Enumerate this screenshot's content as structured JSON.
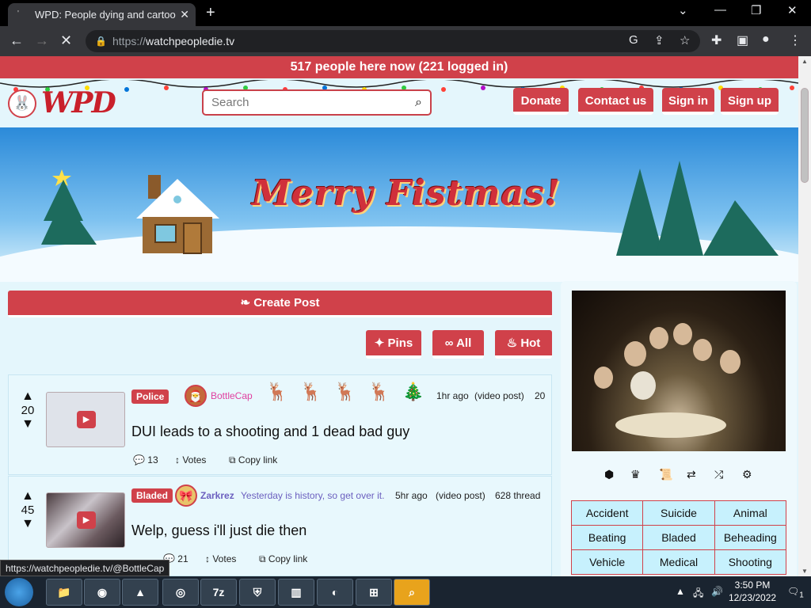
{
  "browser": {
    "tab_title": "WPD: People dying and cartoon",
    "url_proto": "https://",
    "url_host": "watchpeopledie.tv",
    "status_url": "https://watchpeopledie.tv/@BottleCap"
  },
  "site": {
    "banner": "517 people here now (221 logged in)",
    "logo_text": "WPD",
    "search_placeholder": "Search",
    "nav": [
      "Donate",
      "Contact us",
      "Sign in",
      "Sign up"
    ],
    "hero_title": "Merry Fistmas!",
    "create_post": "Create Post",
    "filters": [
      "Pins",
      "All",
      "Hot"
    ]
  },
  "posts": [
    {
      "score": "20",
      "tag": "Police",
      "user": "BottleCap",
      "time": "1hr ago",
      "kind": "(video post)",
      "extra": "20",
      "title": "DUI leads to a shooting and 1 dead bad guy",
      "comments": "13",
      "votes": "Votes",
      "copy": "Copy link"
    },
    {
      "score": "45",
      "tag": "Bladed",
      "user": "Zarkrez",
      "motto": "Yesterday is history, so get over it.",
      "time": "5hr ago",
      "kind": "(video post)",
      "extra": "628 thread",
      "title": "Welp, guess i'll just die then",
      "comments": "21",
      "votes": "Votes",
      "copy": "Copy link"
    }
  ],
  "categories": [
    [
      "Accident",
      "Suicide",
      "Animal"
    ],
    [
      "Beating",
      "Bladed",
      "Beheading"
    ],
    [
      "Vehicle",
      "Medical",
      "Shooting"
    ]
  ],
  "taskbar": {
    "time": "3:50 PM",
    "date": "12/23/2022",
    "app_7z": "7z",
    "notif_count": "1"
  },
  "colors": {
    "accent": "#d0414a",
    "page_bg": "#e4f6fc"
  }
}
